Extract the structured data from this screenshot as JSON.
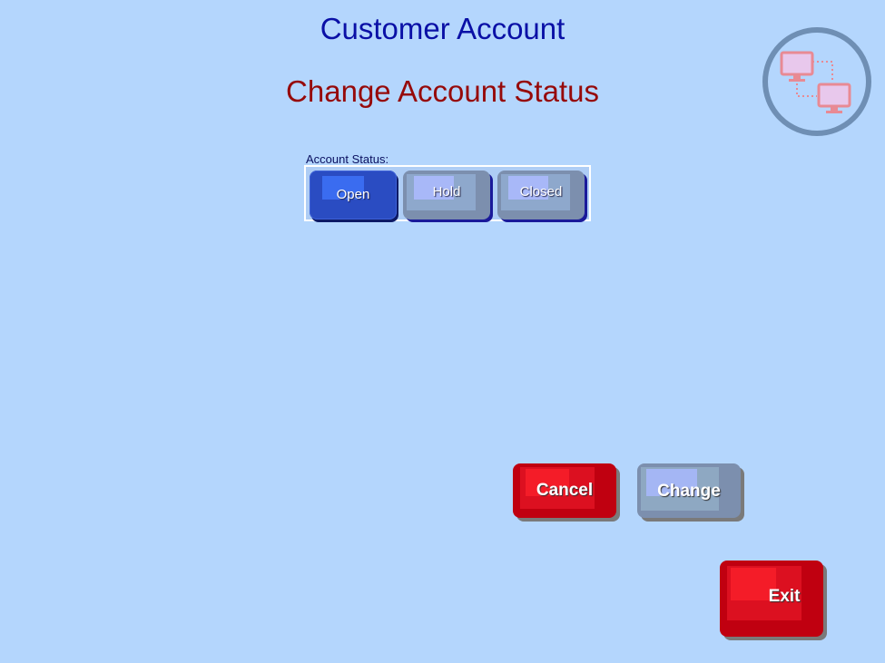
{
  "header": {
    "title": "Customer Account",
    "subtitle": "Change Account Status"
  },
  "logo": {
    "icon": "network-computers-icon"
  },
  "account_status": {
    "label": "Account Status:",
    "options": [
      {
        "label": "Open",
        "selected": true
      },
      {
        "label": "Hold",
        "selected": false
      },
      {
        "label": "Closed",
        "selected": false
      }
    ]
  },
  "actions": {
    "cancel_label": "Cancel",
    "change_label": "Change",
    "exit_label": "Exit"
  },
  "colors": {
    "background": "#b4d6fd",
    "title": "#0a10a6",
    "subtitle": "#960a0a",
    "selected": "#2a4cc2",
    "disabled": "#7c8fae",
    "danger": "#c00010"
  }
}
